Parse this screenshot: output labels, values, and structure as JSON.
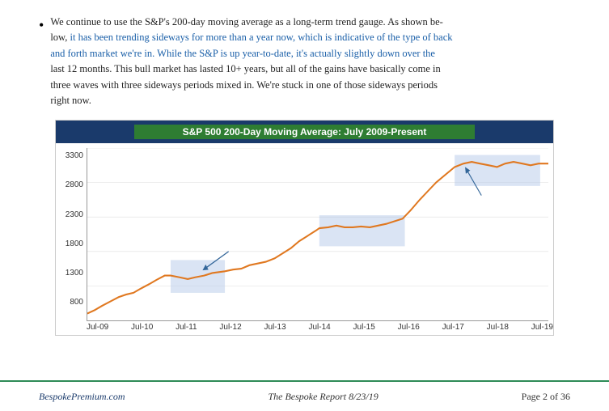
{
  "page": {
    "bullet_text_part1": "We continue to use the S&P's 200-day moving average as a long-term trend gauge.  As shown be-low, it has been trending sideways for more than a year now, which is indicative of the type of back and forth market we're in.  While the S&P is up year-to-date, it's actually slightly down over the last 12 months.  This bull market has lasted 10+ years, but all of the gains have basically come in three waves with three sideways periods mixed in.  We're stuck in one of those sideways periods right now.",
    "chart_title": "S&P 500 200-Day Moving Average: July 2009-Present",
    "y_labels": [
      "3300",
      "2800",
      "2300",
      "1800",
      "1300",
      "800"
    ],
    "x_labels": [
      "Jul-09",
      "Jul-10",
      "Jul-11",
      "Jul-12",
      "Jul-13",
      "Jul-14",
      "Jul-15",
      "Jul-16",
      "Jul-17",
      "Jul-18",
      "Jul-19"
    ],
    "footer": {
      "left": "BespokePremium.com",
      "center": "The Bespoke Report 8/23/19",
      "right": "Page 2 of 36"
    }
  }
}
